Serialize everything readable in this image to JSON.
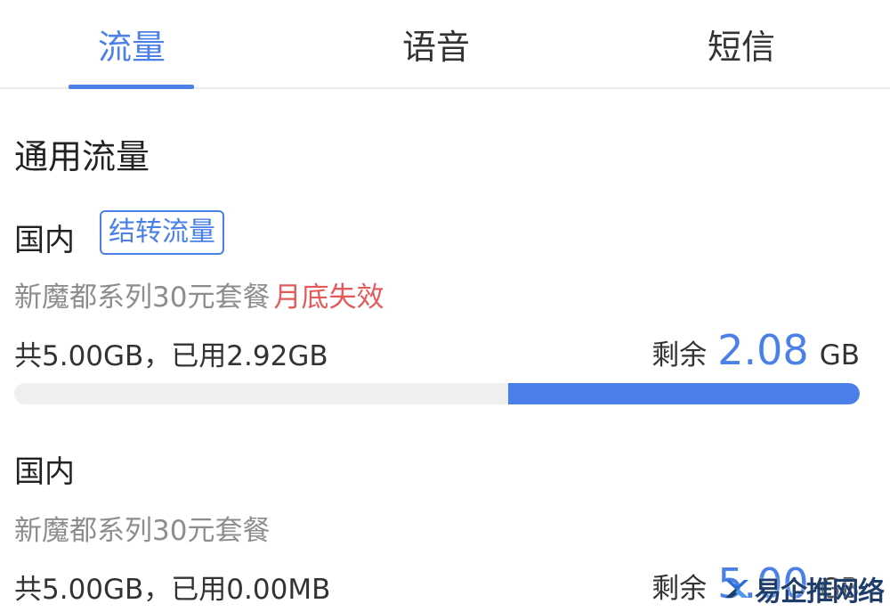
{
  "tabs": [
    {
      "label": "流量",
      "active": true
    },
    {
      "label": "语音",
      "active": false
    },
    {
      "label": "短信",
      "active": false
    }
  ],
  "section_title": "通用流量",
  "packages": [
    {
      "region": "国内",
      "badge": "结转流量",
      "plan": "新魔都系列30元套餐",
      "expiry": "月底失效",
      "total_used": "共5.00GB，已用2.92GB",
      "remain_label": "剩余",
      "remain_value": "2.08",
      "remain_unit": "GB",
      "remaining_fraction": 0.416
    },
    {
      "region": "国内",
      "plan": "新魔都系列30元套餐",
      "total_used": "共5.00GB，已用0.00MB",
      "remain_label": "剩余",
      "remain_value": "5.00",
      "remain_unit": "GB"
    }
  ],
  "watermark": {
    "text": "易企推网络",
    "icon": "logo-icon"
  },
  "colors": {
    "accent": "#4b80e8",
    "warning": "#e35a5a",
    "muted": "#8d8d8d"
  }
}
